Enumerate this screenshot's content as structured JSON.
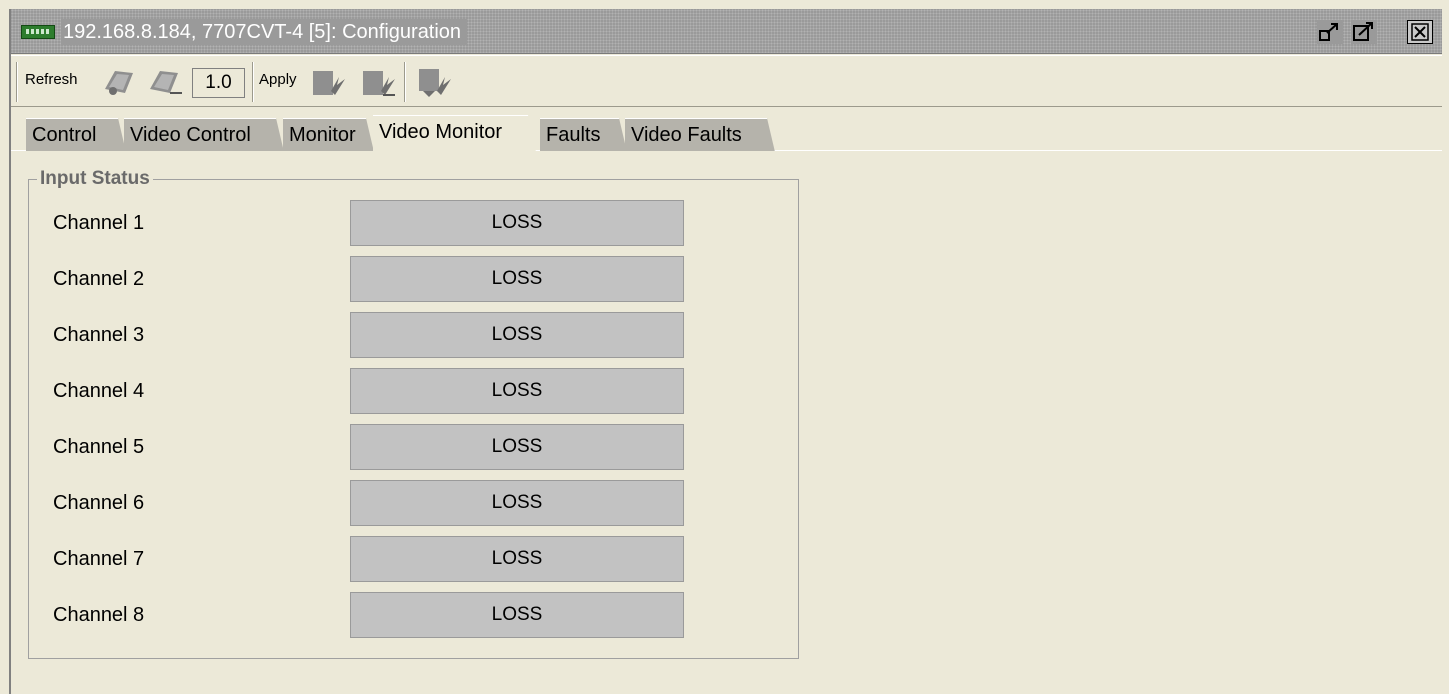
{
  "window": {
    "title": "192.168.8.184, 7707CVT-4  [5]: Configuration",
    "icons": {
      "app": "card-icon",
      "restore": "restore-icon",
      "maximize": "maximize-icon",
      "close": "close-icon"
    }
  },
  "toolbar": {
    "refresh_label": "Refresh",
    "value": "1.0",
    "apply_label": "Apply"
  },
  "tabs": [
    {
      "label": "Control",
      "active": false
    },
    {
      "label": "Video Control",
      "active": false
    },
    {
      "label": "Monitor",
      "active": false
    },
    {
      "label": "Video Monitor",
      "active": true
    },
    {
      "label": "Faults",
      "active": false
    },
    {
      "label": "Video Faults",
      "active": false
    }
  ],
  "input_status": {
    "title": "Input Status",
    "channels": [
      {
        "label": "Channel 1",
        "status": "LOSS"
      },
      {
        "label": "Channel 2",
        "status": "LOSS"
      },
      {
        "label": "Channel 3",
        "status": "LOSS"
      },
      {
        "label": "Channel 4",
        "status": "LOSS"
      },
      {
        "label": "Channel 5",
        "status": "LOSS"
      },
      {
        "label": "Channel 6",
        "status": "LOSS"
      },
      {
        "label": "Channel 7",
        "status": "LOSS"
      },
      {
        "label": "Channel 8",
        "status": "LOSS"
      }
    ]
  }
}
